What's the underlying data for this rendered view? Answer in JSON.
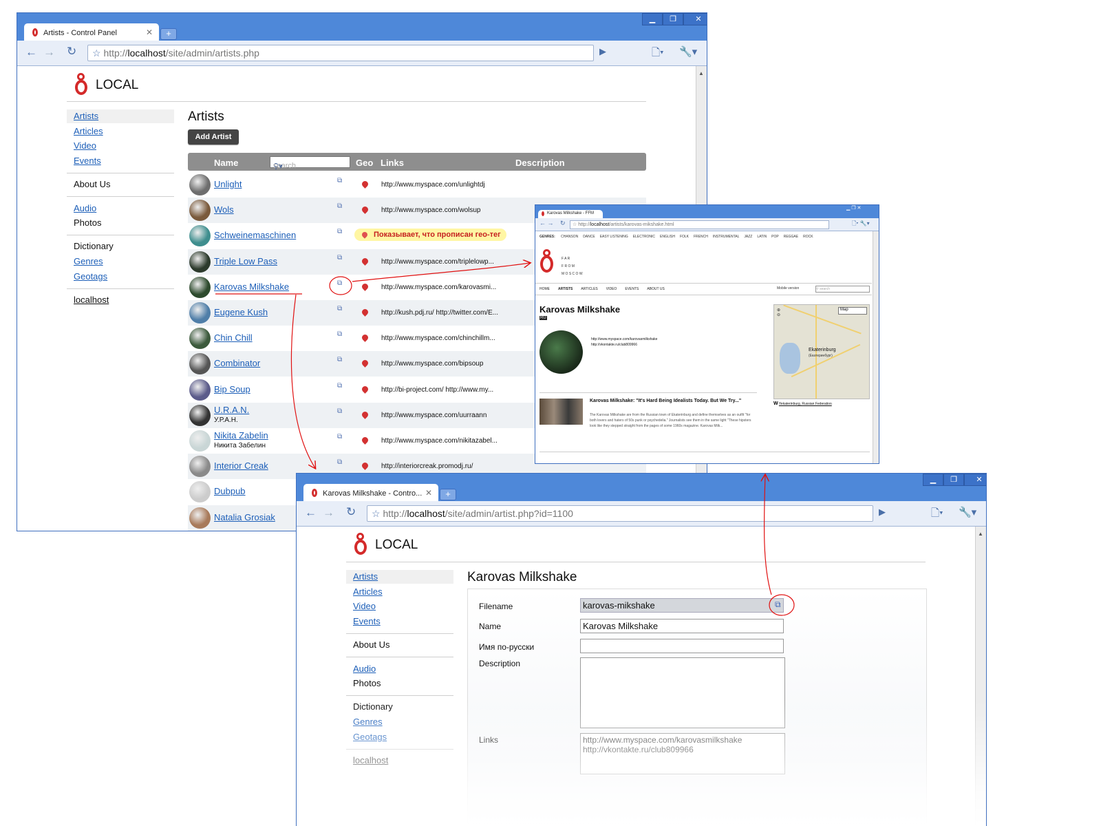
{
  "window1": {
    "tab_title": "Artists - Control Panel",
    "url_prefix": "http://",
    "url_host": "localhost",
    "url_path": "/site/admin/artists.php",
    "brand": "LOCAL",
    "page_title": "Artists",
    "add_button": "Add Artist",
    "search_placeholder": "search",
    "columns": {
      "name": "Name",
      "geo": "Geo",
      "links": "Links",
      "description": "Description"
    },
    "nav": {
      "artists": "Artists",
      "articles": "Articles",
      "video": "Video",
      "events": "Events",
      "about": "About Us",
      "audio": "Audio",
      "photos": "Photos",
      "dictionary": "Dictionary",
      "genres": "Genres",
      "geotags": "Geotags",
      "localhost": "localhost"
    },
    "rows": [
      {
        "name": "Unlight",
        "sub": "",
        "link": "http://www.myspace.com/unlightdj",
        "avatar": "#6d6d6d"
      },
      {
        "name": "Wols",
        "sub": "",
        "link": "http://www.myspace.com/wolsup",
        "avatar": "#7a5a3c"
      },
      {
        "name": "Schweinemaschinen",
        "sub": "",
        "link": "",
        "avatar": "#3e8e8e"
      },
      {
        "name": "Triple Low Pass",
        "sub": "",
        "link": "http://www.myspace.com/triplelowp...",
        "avatar": "#2c3a2c"
      },
      {
        "name": "Karovas Milkshake",
        "sub": "",
        "link": "http://www.myspace.com/karovasmi...",
        "avatar": "#2d4a2d"
      },
      {
        "name": "Eugene Kush",
        "sub": "",
        "link": "http://kush.pdj.ru/ http://twitter.com/E...",
        "avatar": "#4f7ea8"
      },
      {
        "name": "Chin Chill",
        "sub": "",
        "link": "http://www.myspace.com/chinchillm...",
        "avatar": "#3c5a3c"
      },
      {
        "name": "Combinator",
        "sub": "",
        "link": "http://www.myspace.com/bipsoup",
        "avatar": "#555555"
      },
      {
        "name": "Bip Soup",
        "sub": "",
        "link": "http://bi-project.com/ http://www.my...",
        "avatar": "#5b5b8a"
      },
      {
        "name": "U.R.A.N.",
        "sub": "У.Р.А.Н.",
        "link": "http://www.myspace.com/uurraann",
        "avatar": "#333333"
      },
      {
        "name": "Nikita Zabelin",
        "sub": "Никита Забелин",
        "link": "http://www.myspace.com/nikitazabel...",
        "avatar": "#c9d6d6"
      },
      {
        "name": "Interior Creak",
        "sub": "",
        "link": "http://interiorcreak.promodj.ru/",
        "avatar": "#8a8a8a"
      },
      {
        "name": "Dubpub",
        "sub": "",
        "link": "",
        "avatar": "#cccccc"
      },
      {
        "name": "Natalia Grosiak",
        "sub": "",
        "link": "",
        "avatar": "#a87a5a"
      }
    ],
    "geo_tooltip": "Показывает, что прописан гео-тег"
  },
  "window2": {
    "tab_title": "Karovas Milkshake - FFM",
    "url_prefix": "http://",
    "url_host": "localhost",
    "url_path": "/artists/karovas-mikshake.html",
    "genres_label": "GENRES:",
    "genres": [
      "CHANSON",
      "DANCE",
      "EASY LISTENING",
      "ELECTRONIC",
      "ENGLISH",
      "FOLK",
      "FRENCH",
      "INSTRUMENTAL",
      "JAZZ",
      "LATIN",
      "POP",
      "REGGAE",
      "ROCK"
    ],
    "brand_lines": [
      "F A R",
      "F R O M",
      "M O S C O W"
    ],
    "nav": [
      "HOME",
      "ARTISTS",
      "ARTICLES",
      "VIDEO",
      "EVENTS",
      "ABOUT US"
    ],
    "mobile": "Mobile version",
    "search_placeholder": "search",
    "artist_name": "Karovas Milkshake",
    "badge": "RU",
    "links": [
      "http://www.myspace.com/karovasmilkshake",
      "http://vkontakte.ru/club809966"
    ],
    "map_button": "Map",
    "map_city": "Ekaterinburg",
    "map_city_ru": "(Екатеринбург)",
    "map_caption": "Yekaterinburg, Russian Federation",
    "article_title": "Karovas Milkshake: \"It's Hard Being Idealists Today. But We Try...\"",
    "article_text": "The Karovas Milkshake are from the Russian town of Ekaterinburg and define themselves as an outfit \"for both lovers and haters of 50s punk or psychedelia.\" Journalists see them in the same light \"These hipsters look like they stepped straight from the pages of some 1960s magazine. Karovas Milk..."
  },
  "window3": {
    "tab_title": "Karovas Milkshake - Contro...",
    "url_prefix": "http://",
    "url_host": "localhost",
    "url_path": "/site/admin/artist.php?id=1100",
    "brand": "LOCAL",
    "page_title": "Karovas Milkshake",
    "nav": {
      "artists": "Artists",
      "articles": "Articles",
      "video": "Video",
      "events": "Events",
      "about": "About Us",
      "audio": "Audio",
      "photos": "Photos",
      "dictionary": "Dictionary",
      "genres": "Genres",
      "geotags": "Geotags",
      "localhost": "localhost"
    },
    "form": {
      "filename_label": "Filename",
      "filename_value": "karovas-mikshake",
      "name_label": "Name",
      "name_value": "Karovas Milkshake",
      "ru_label": "Имя по-русски",
      "ru_value": "",
      "description_label": "Description",
      "description_value": "",
      "links_label": "Links",
      "links_value": [
        "http://www.myspace.com/karovasmilkshake",
        "http://vkontakte.ru/club809966"
      ]
    }
  },
  "colors": {
    "accent": "#d42a2a",
    "link": "#1d5fb8",
    "titlebar": "#4e88d9",
    "annotation": "#e01010"
  }
}
